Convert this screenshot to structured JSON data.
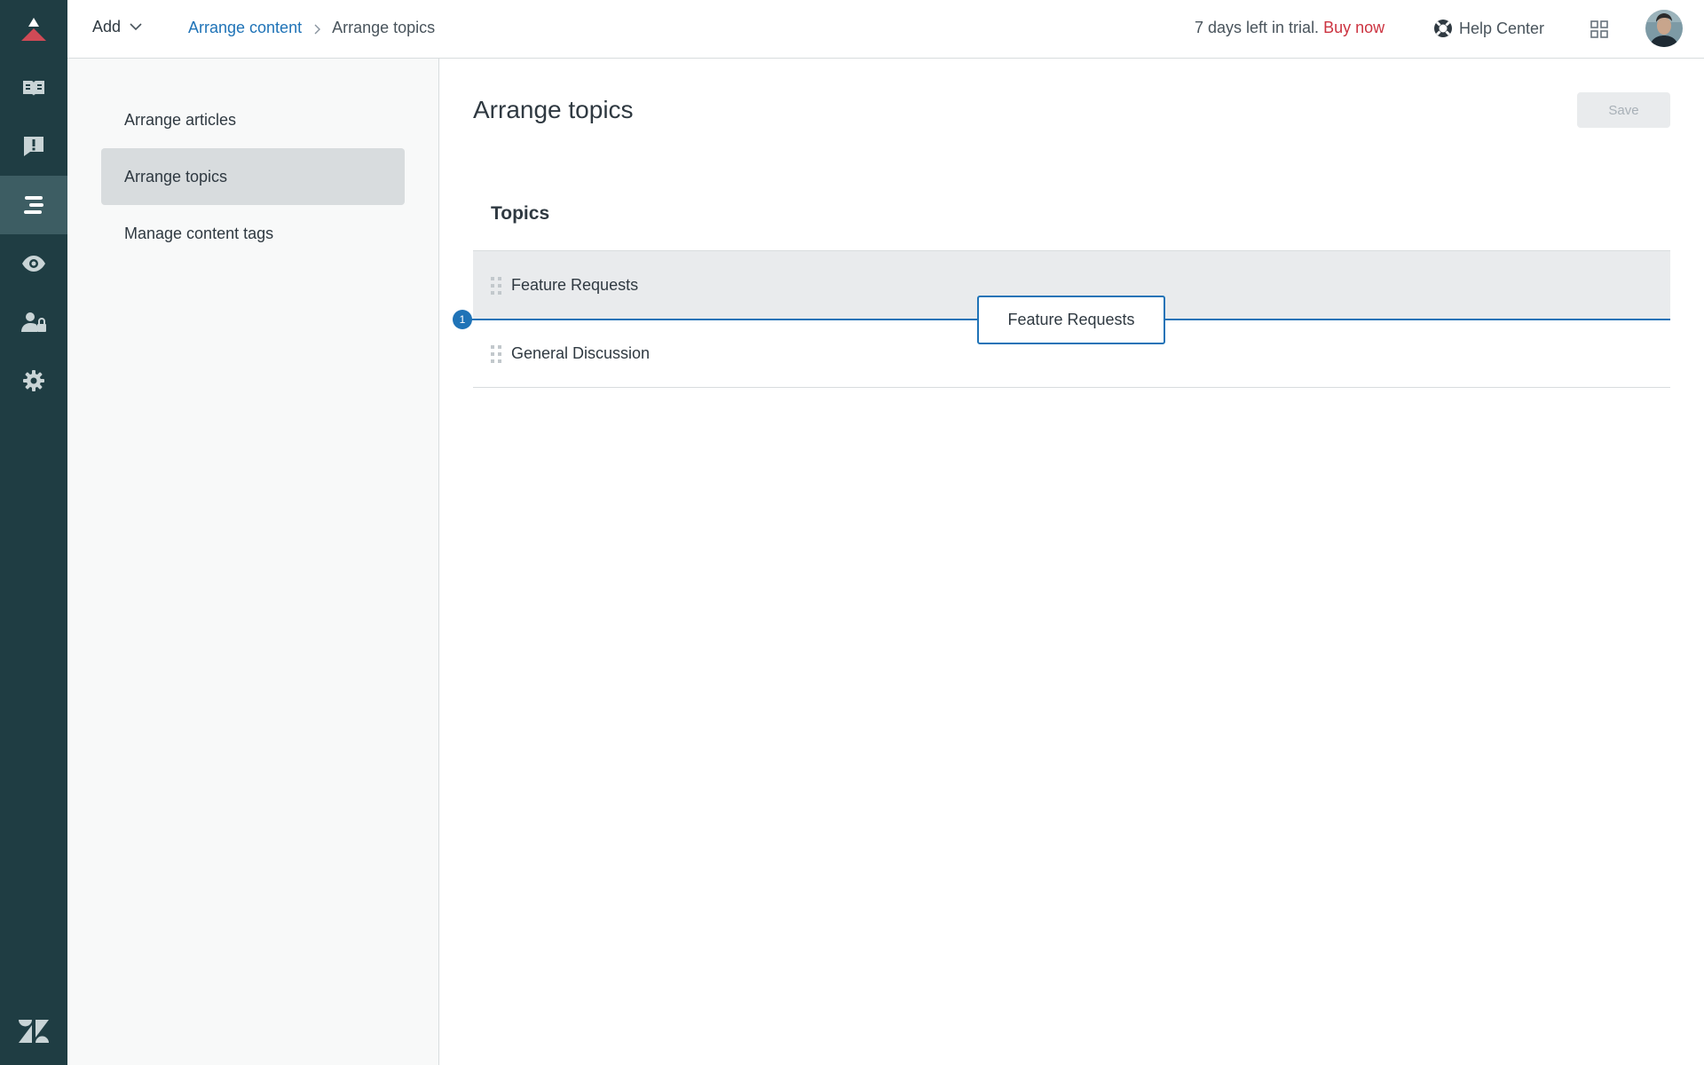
{
  "header": {
    "add_label": "Add",
    "breadcrumb": {
      "parent": "Arrange content",
      "current": "Arrange topics"
    },
    "trial_text": "7 days left in trial.",
    "buy_now": "Buy now",
    "help_center": "Help Center"
  },
  "rail": {
    "items": [
      {
        "icon": "knowledge-base-icon",
        "active": false
      },
      {
        "icon": "community-alert-icon",
        "active": false
      },
      {
        "icon": "arrange-content-icon",
        "active": true
      },
      {
        "icon": "eye-icon",
        "active": false
      },
      {
        "icon": "user-permissions-icon",
        "active": false
      },
      {
        "icon": "gear-icon",
        "active": false
      }
    ]
  },
  "sidebar": {
    "items": [
      {
        "label": "Arrange articles",
        "selected": false
      },
      {
        "label": "Arrange topics",
        "selected": true
      },
      {
        "label": "Manage content tags",
        "selected": false
      }
    ]
  },
  "main": {
    "title": "Arrange topics",
    "save_label": "Save",
    "section_title": "Topics",
    "topics": [
      {
        "label": "Feature Requests"
      },
      {
        "label": "General Discussion"
      }
    ],
    "drop_index": "1",
    "drag_ghost_label": "Feature Requests"
  },
  "colors": {
    "rail_bg": "#1f3d43",
    "accent": "#1f73b7",
    "buy_now": "#cc3340",
    "brand_triangle": "#d04a56"
  }
}
